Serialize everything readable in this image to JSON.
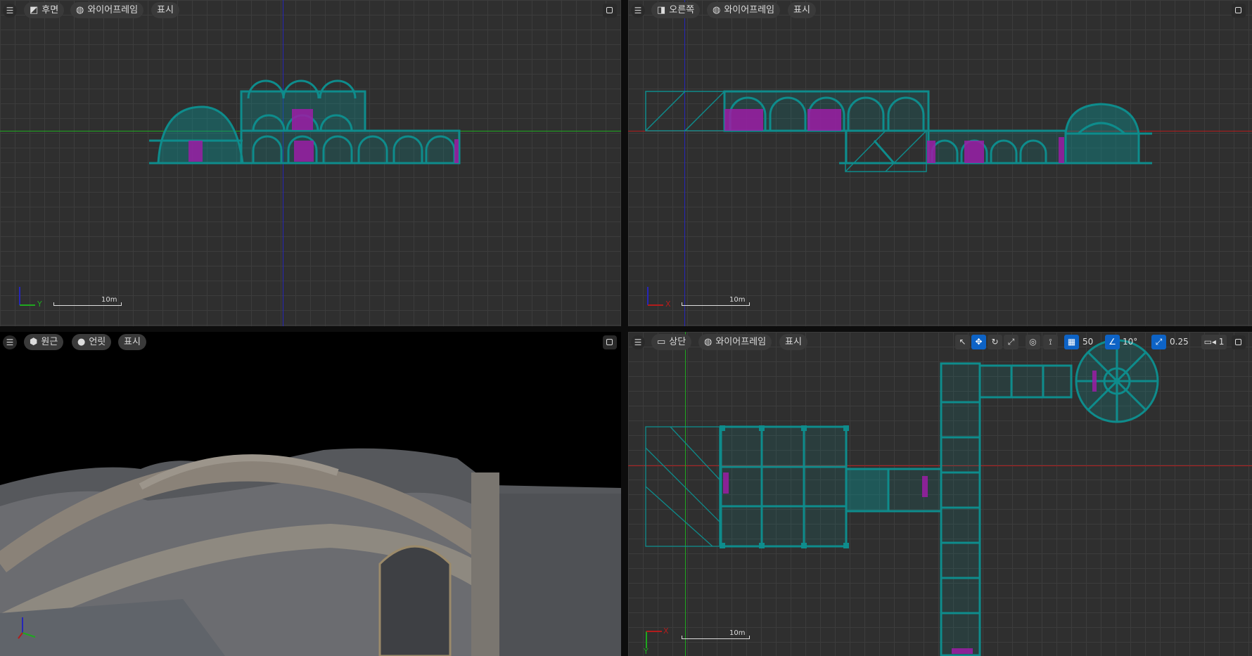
{
  "viewports": {
    "back": {
      "view_label": "후면",
      "render_mode": "와이어프레임",
      "show_label": "표시",
      "scale_label": "10m",
      "axis_h": "Y"
    },
    "right": {
      "view_label": "오른쪽",
      "render_mode": "와이어프레임",
      "show_label": "표시",
      "scale_label": "10m",
      "axis_h": "X"
    },
    "perspective": {
      "view_label": "원근",
      "render_mode": "언릿",
      "show_label": "표시"
    },
    "top": {
      "view_label": "상단",
      "render_mode": "와이어프레임",
      "show_label": "표시",
      "scale_label": "10m",
      "axis_h": "X",
      "axis_v": "Y",
      "grid_snap": "50",
      "rot_snap": "10°",
      "scale_snap": "0.25",
      "camera_speed": "1"
    }
  },
  "colors": {
    "wire": "#0e8c8c",
    "accent": "#9b1da6",
    "axis_green": "#1fa81f",
    "axis_red": "#b21c1c",
    "axis_blue": "#2626b8",
    "active_blue": "#0d63c6"
  },
  "icons": {
    "menu": "hamburger-icon",
    "maximize": "maximize-icon",
    "select": "select-icon",
    "move": "move-icon",
    "rotate": "rotate-icon",
    "scale": "scale-icon",
    "world": "world-space-icon",
    "surface": "surface-snap-icon",
    "grid": "grid-snap-icon",
    "angle": "angle-snap-icon",
    "scale_snap": "scale-snap-icon",
    "camera": "camera-speed-icon"
  }
}
